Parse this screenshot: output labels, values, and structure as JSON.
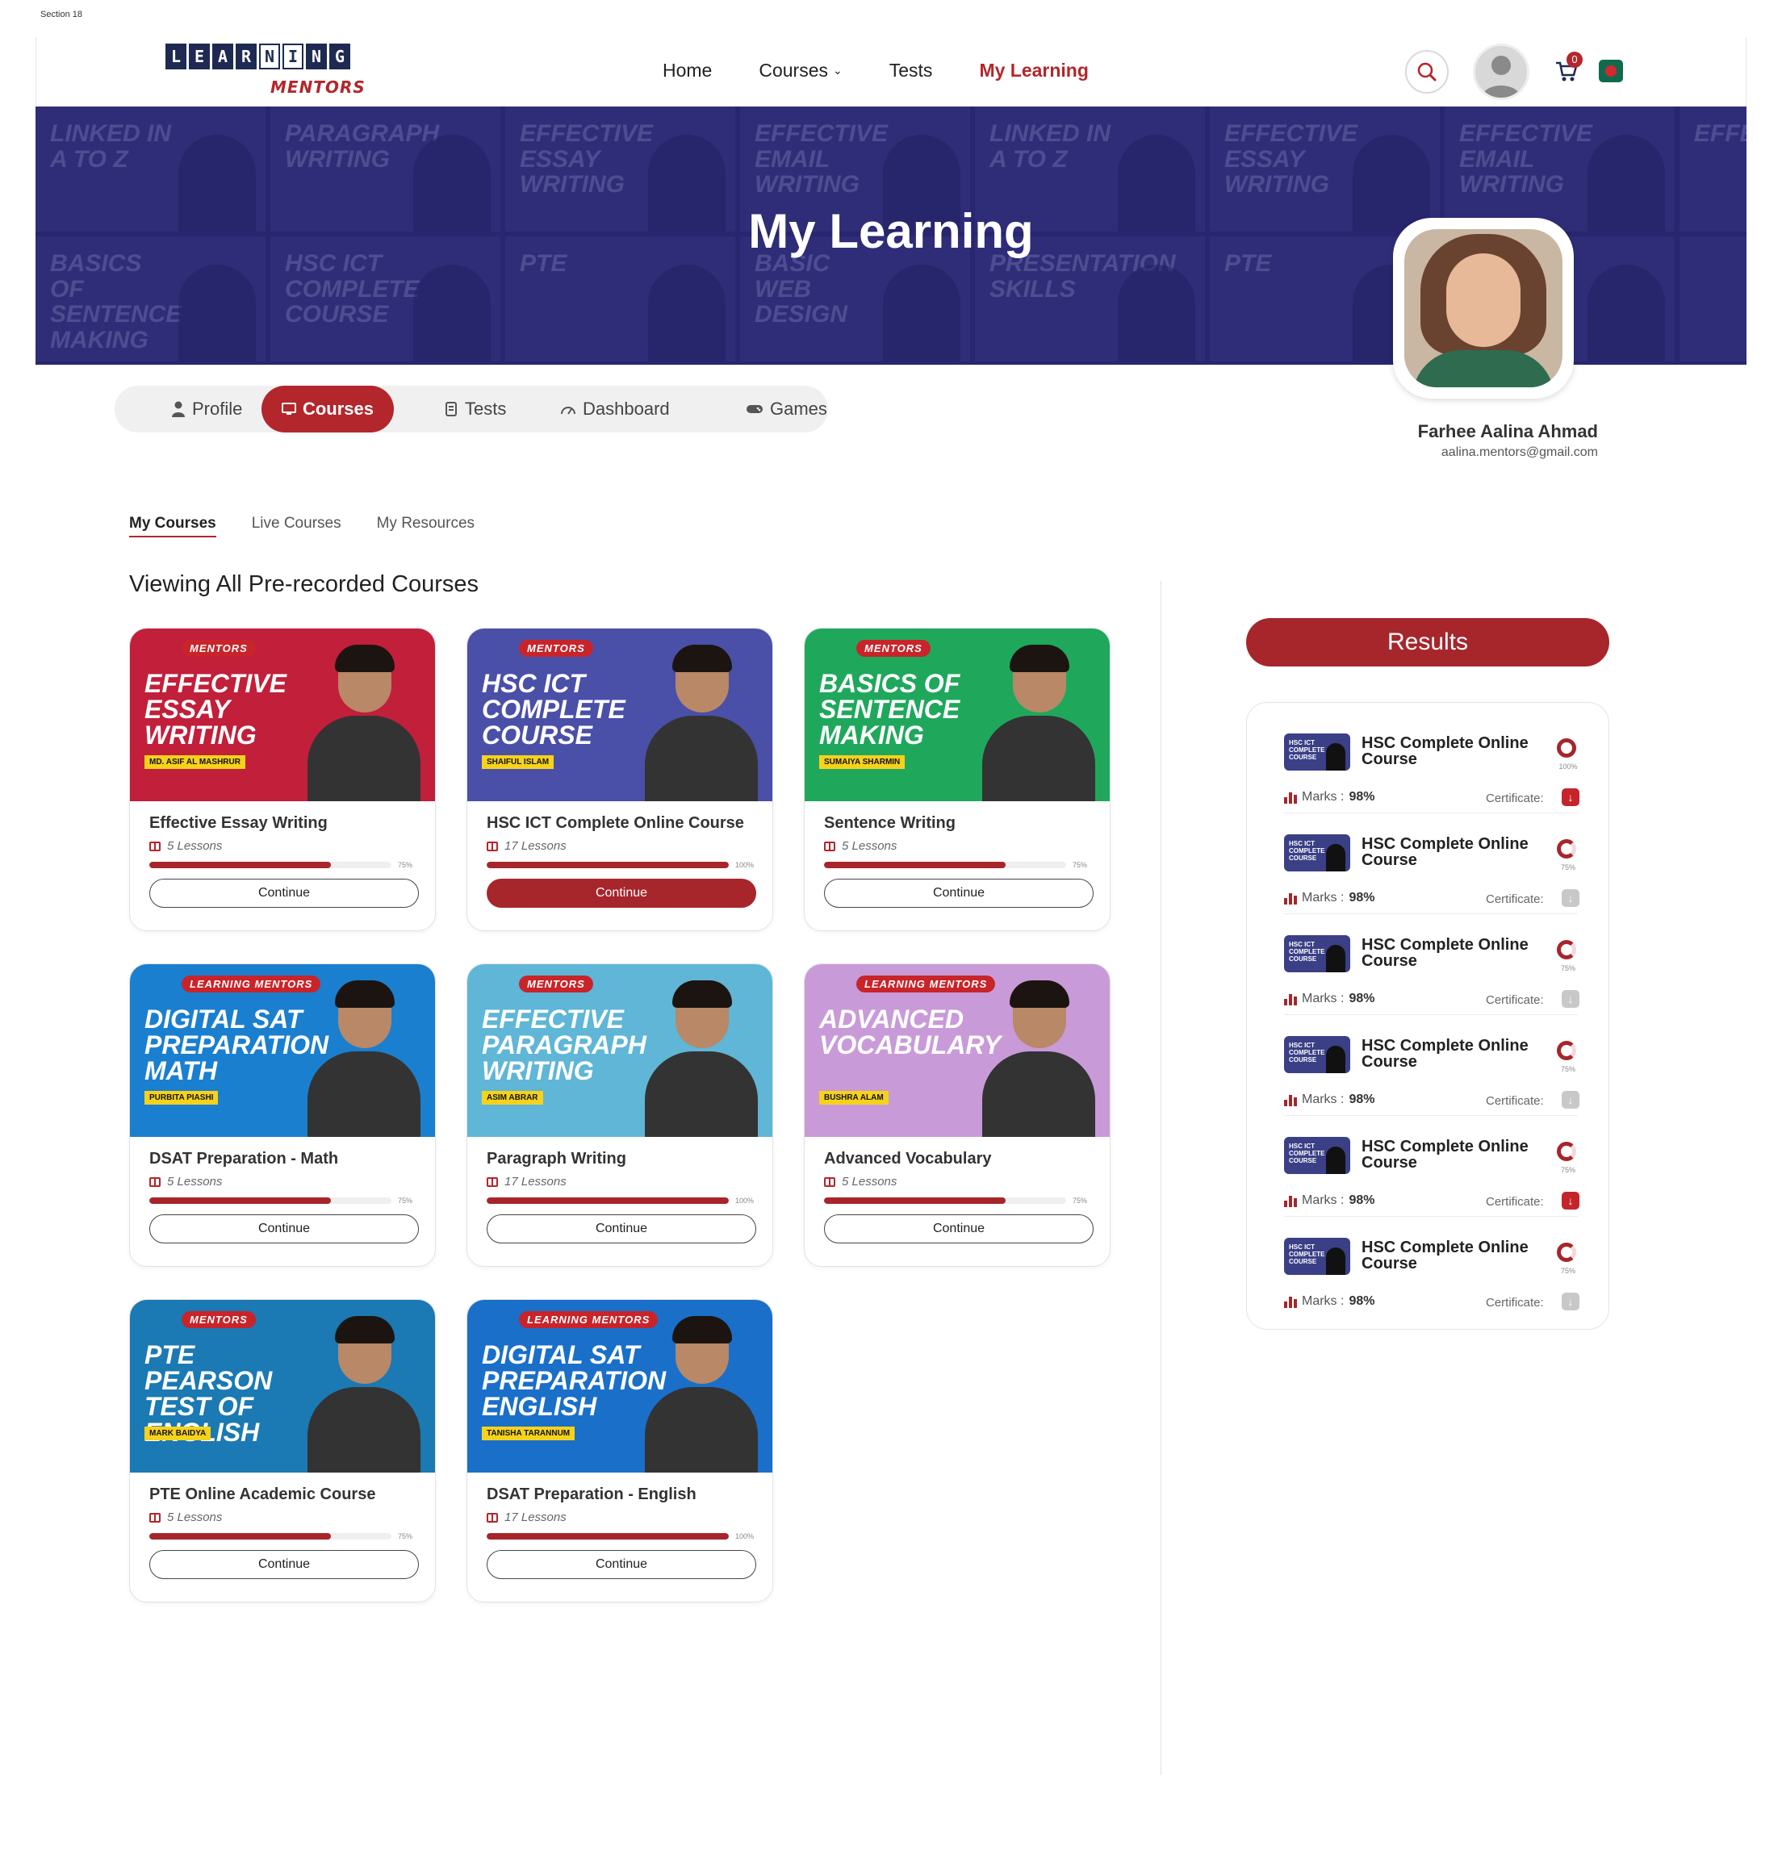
{
  "section_label": "Section 18",
  "logo": {
    "word_tiles": [
      "L",
      "E",
      "A",
      "R",
      "N",
      "I",
      "N",
      "G"
    ],
    "sub": "MENTORS"
  },
  "nav": {
    "home": "Home",
    "courses": "Courses",
    "tests": "Tests",
    "my_learning": "My Learning"
  },
  "cart_count": "0",
  "banner": {
    "title": "My Learning",
    "tiles": [
      "LINKED IN A TO Z",
      "PARAGRAPH WRITING",
      "EFFECTIVE ESSAY WRITING",
      "EFFECTIVE EMAIL WRITING",
      "LINKED IN A TO Z",
      "EFFECTIVE ESSAY WRITING",
      "EFFECTIVE EMAIL WRITING",
      "EFFECTIVE",
      "BASICS OF SENTENCE MAKING",
      "HSC ICT COMPLETE COURSE",
      "PTE",
      "BASIC WEB DESIGN",
      "PRESENTATION SKILLS",
      "PTE",
      "",
      ""
    ]
  },
  "user": {
    "name": "Farhee Aalina Ahmad",
    "email": "aalina.mentors@gmail.com"
  },
  "profile_tabs": {
    "profile": "Profile",
    "courses": "Courses",
    "tests": "Tests",
    "dashboard": "Dashboard",
    "games": "Games"
  },
  "sub_tabs": {
    "my_courses": "My Courses",
    "live_courses": "Live Courses",
    "my_resources": "My Resources"
  },
  "view_title": "Viewing All Pre-recorded Courses",
  "courses": [
    {
      "title": "Effective Essay Writing",
      "lessons": "5 Lessons",
      "progress": 0.75,
      "progress_label": "75%",
      "button": "Continue",
      "thumb_text": "EFFECTIVE ESSAY WRITING",
      "thumb_tag": "MD. ASIF AL MASHRUR",
      "brand": "MENTORS",
      "bg": "#c11f3a"
    },
    {
      "title": "HSC ICT Complete Online Course",
      "lessons": "17 Lessons",
      "progress": 1.0,
      "progress_label": "100%",
      "button": "Continue",
      "thumb_text": "HSC ICT COMPLETE COURSE",
      "thumb_tag": "SHAIFUL ISLAM",
      "brand": "MENTORS",
      "bg": "#4a4fa8"
    },
    {
      "title": "Sentence Writing",
      "lessons": "5 Lessons",
      "progress": 0.75,
      "progress_label": "75%",
      "button": "Continue",
      "thumb_text": "BASICS OF SENTENCE MAKING",
      "thumb_tag": "SUMAIYA SHARMIN",
      "brand": "MENTORS",
      "bg": "#1fa85c"
    },
    {
      "title": "DSAT Preparation - Math",
      "lessons": "5 Lessons",
      "progress": 0.75,
      "progress_label": "75%",
      "button": "Continue",
      "thumb_text": "DIGITAL SAT PREPARATION MATH",
      "thumb_tag": "PURBITA PIASHI",
      "brand": "LEARNING MENTORS",
      "bg": "#1a7fcf"
    },
    {
      "title": "Paragraph Writing",
      "lessons": "17 Lessons",
      "progress": 1.0,
      "progress_label": "100%",
      "button": "Continue",
      "thumb_text": "EFFECTIVE PARAGRAPH WRITING",
      "thumb_tag": "ASIM ABRAR",
      "brand": "MENTORS",
      "bg": "#5fb6d6"
    },
    {
      "title": "Advanced Vocabulary",
      "lessons": "5 Lessons",
      "progress": 0.75,
      "progress_label": "75%",
      "button": "Continue",
      "thumb_text": "ADVANCED VOCABULARY",
      "thumb_tag": "BUSHRA ALAM",
      "brand": "LEARNING MENTORS",
      "bg": "#c99ad8"
    },
    {
      "title": "PTE Online Academic Course",
      "lessons": "5 Lessons",
      "progress": 0.75,
      "progress_label": "75%",
      "button": "Continue",
      "thumb_text": "PTE Pearson Test of English",
      "thumb_tag": "MARK BAIDYA",
      "brand": "MENTORS",
      "bg": "#1b79b3"
    },
    {
      "title": "DSAT Preparation - English",
      "lessons": "17 Lessons",
      "progress": 1.0,
      "progress_label": "100%",
      "button": "Continue",
      "thumb_text": "DIGITAL SAT PREPARATION ENGLISH",
      "thumb_tag": "TANISHA TARANNUM",
      "brand": "LEARNING MENTORS",
      "bg": "#1a6fc9"
    }
  ],
  "results": {
    "title": "Results",
    "items": [
      {
        "title": "HSC Complete Online Course",
        "progress_label": "100%",
        "marks_label": "Marks :",
        "marks": "98%",
        "certificate_label": "Certificate:",
        "cert_available": true
      },
      {
        "title": "HSC Complete Online Course",
        "progress_label": "75%",
        "marks_label": "Marks :",
        "marks": "98%",
        "certificate_label": "Certificate:",
        "cert_available": false
      },
      {
        "title": "HSC Complete Online Course",
        "progress_label": "75%",
        "marks_label": "Marks :",
        "marks": "98%",
        "certificate_label": "Certificate:",
        "cert_available": false
      },
      {
        "title": "HSC Complete Online Course",
        "progress_label": "75%",
        "marks_label": "Marks :",
        "marks": "98%",
        "certificate_label": "Certificate:",
        "cert_available": false
      },
      {
        "title": "HSC Complete Online Course",
        "progress_label": "75%",
        "marks_label": "Marks :",
        "marks": "98%",
        "certificate_label": "Certificate:",
        "cert_available": true
      },
      {
        "title": "HSC Complete Online Course",
        "progress_label": "75%",
        "marks_label": "Marks :",
        "marks": "98%",
        "certificate_label": "Certificate:",
        "cert_available": false
      }
    ]
  },
  "colors": {
    "accent": "#a6262b",
    "banner": "#2c2c70"
  }
}
